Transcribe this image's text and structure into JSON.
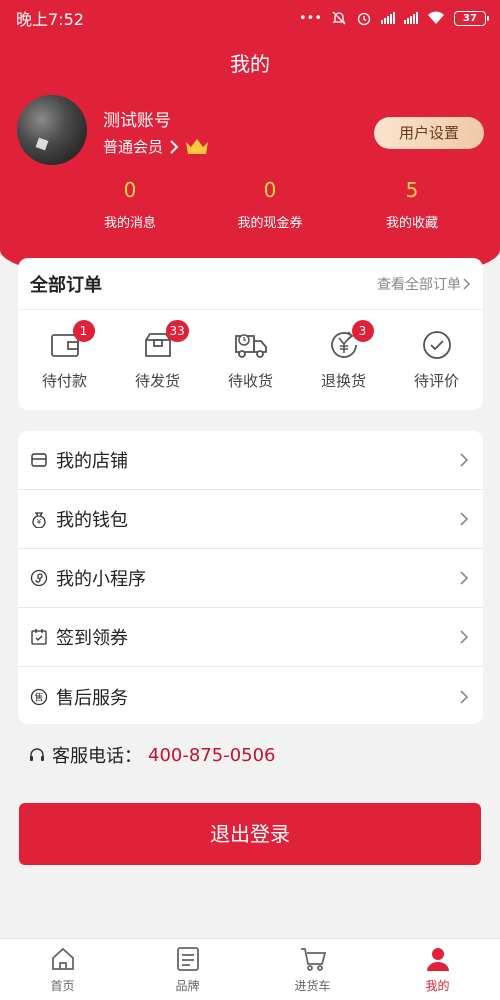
{
  "status_bar": {
    "time": "晚上7:52",
    "battery": "37"
  },
  "header": {
    "title": "我的"
  },
  "profile": {
    "username": "测试账号",
    "member_level": "普通会员",
    "settings_label": "用户设置"
  },
  "stats": [
    {
      "value": "0",
      "label": "我的消息"
    },
    {
      "value": "0",
      "label": "我的现金券"
    },
    {
      "value": "5",
      "label": "我的收藏"
    }
  ],
  "orders": {
    "title": "全部订单",
    "view_all": "查看全部订单",
    "items": [
      {
        "label": "待付款",
        "badge": "1",
        "icon": "wallet-icon"
      },
      {
        "label": "待发货",
        "badge": "33",
        "icon": "package-icon"
      },
      {
        "label": "待收货",
        "badge": "",
        "icon": "truck-icon"
      },
      {
        "label": "退换货",
        "badge": "3",
        "icon": "yen-return-icon"
      },
      {
        "label": "待评价",
        "badge": "",
        "icon": "check-circle-icon"
      }
    ]
  },
  "menu": [
    {
      "label": "我的店铺",
      "icon": "store-icon"
    },
    {
      "label": "我的钱包",
      "icon": "money-bag-icon"
    },
    {
      "label": "我的小程序",
      "icon": "mini-program-icon"
    },
    {
      "label": "签到领券",
      "icon": "calendar-check-icon"
    },
    {
      "label": "售后服务",
      "icon": "after-sales-icon"
    }
  ],
  "service": {
    "label": "客服电话：",
    "phone": "400-875-0506"
  },
  "logout_label": "退出登录",
  "bottom_nav": [
    {
      "label": "首页",
      "icon": "home-icon",
      "active": false
    },
    {
      "label": "品牌",
      "icon": "brand-list-icon",
      "active": false
    },
    {
      "label": "进货车",
      "icon": "cart-icon",
      "active": false
    },
    {
      "label": "我的",
      "icon": "user-icon",
      "active": true
    }
  ],
  "colors": {
    "primary": "#e0213a",
    "stat_number": "#ffd24d",
    "phone": "#c8102e"
  }
}
